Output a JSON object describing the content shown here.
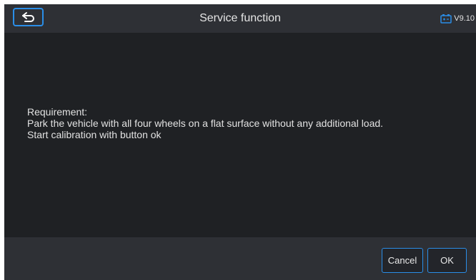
{
  "header": {
    "title": "Service function",
    "version": "V9.10",
    "back_icon": "back-arrow-icon",
    "battery_icon": "battery-icon"
  },
  "message": {
    "lines": [
      "Requirement:",
      "Park the vehicle with all four wheels on a flat surface without any additional load.",
      "Start calibration with button ok"
    ]
  },
  "footer": {
    "cancel_label": "Cancel",
    "ok_label": "OK"
  },
  "colors": {
    "accent": "#2a8ee8",
    "background": "#1f2124",
    "bar": "#2e3035"
  }
}
